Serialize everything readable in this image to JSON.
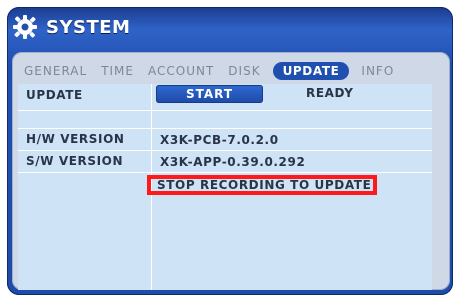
{
  "window": {
    "title": "SYSTEM"
  },
  "tabs": [
    {
      "label": "GENERAL",
      "active": false
    },
    {
      "label": "TIME",
      "active": false
    },
    {
      "label": "ACCOUNT",
      "active": false
    },
    {
      "label": "DISK",
      "active": false
    },
    {
      "label": "UPDATE",
      "active": true
    },
    {
      "label": "INFO",
      "active": false
    }
  ],
  "update": {
    "label": "UPDATE",
    "start_label": "START",
    "status": "READY"
  },
  "hw_version": {
    "label": "H/W VERSION",
    "value": "X3K-PCB-7.0.2.0"
  },
  "sw_version": {
    "label": "S/W VERSION",
    "value": "X3K-APP-0.39.0.292"
  },
  "notice": {
    "text": "STOP RECORDING TO UPDATE"
  },
  "colors": {
    "accent": "#1f4faf",
    "warning": "#ff1a1a",
    "panel": "#cfe3f6"
  },
  "icons": {
    "title_icon": "gear-icon"
  }
}
